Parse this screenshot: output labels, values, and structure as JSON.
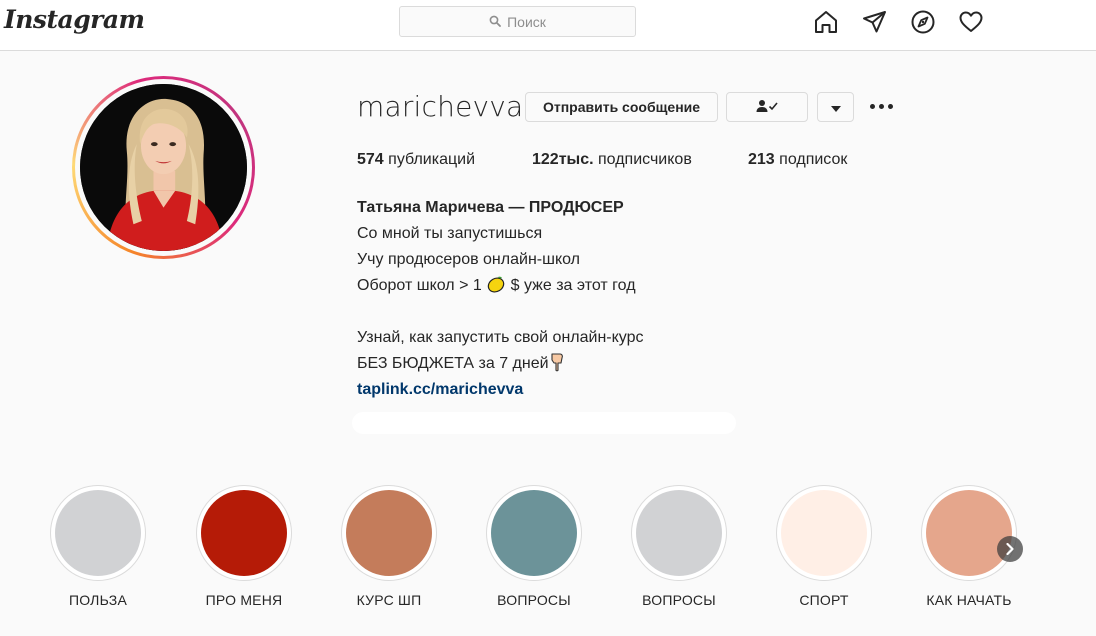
{
  "header": {
    "logo": "Instagram",
    "search_placeholder": "Поиск",
    "icons": [
      "home-icon",
      "direct-icon",
      "explore-icon",
      "activity-icon"
    ]
  },
  "profile": {
    "username": "marichevva",
    "buttons": {
      "message": "Отправить сообщение",
      "following_icon": "person-check-icon",
      "dropdown_icon": "chevron-down-icon",
      "more_icon": "more-options-icon"
    },
    "stats": {
      "posts_count": "574",
      "posts_label": "публикаций",
      "followers_count": "122тыс.",
      "followers_label": "подписчиков",
      "following_count": "213",
      "following_label": "подписок"
    },
    "bio": {
      "full_name": "Татьяна Маричева — ПРОДЮСЕР",
      "line1": "Со мной ты запустишься",
      "line2": "Учу продюсеров онлайн-школ",
      "line3_before": "Оборот школ > 1 ",
      "line3_after": " $ уже за этот год",
      "line4": "Узнай, как запустить свой онлайн-курс",
      "line5": "БЕЗ БЮДЖЕТА за 7 дней",
      "link": "taplink.cc/marichevva"
    }
  },
  "highlights": [
    {
      "label": "ПОЛЬЗА",
      "color": "#d1d2d4"
    },
    {
      "label": "ПРО МЕНЯ",
      "color": "#b51b07"
    },
    {
      "label": "КУРС ШП",
      "color": "#c47c5b"
    },
    {
      "label": "ВОПРОСЫ",
      "color": "#6c9399"
    },
    {
      "label": "ВОПРОСЫ",
      "color": "#d1d2d4"
    },
    {
      "label": "СПОРТ",
      "color": "#ffefe6"
    },
    {
      "label": "КАК НАЧАТЬ",
      "color": "#e5a68c"
    }
  ],
  "colors": {
    "link": "#00376b",
    "ring_gradient": [
      "#f58529",
      "#dd2a7b",
      "#c1357f"
    ]
  }
}
